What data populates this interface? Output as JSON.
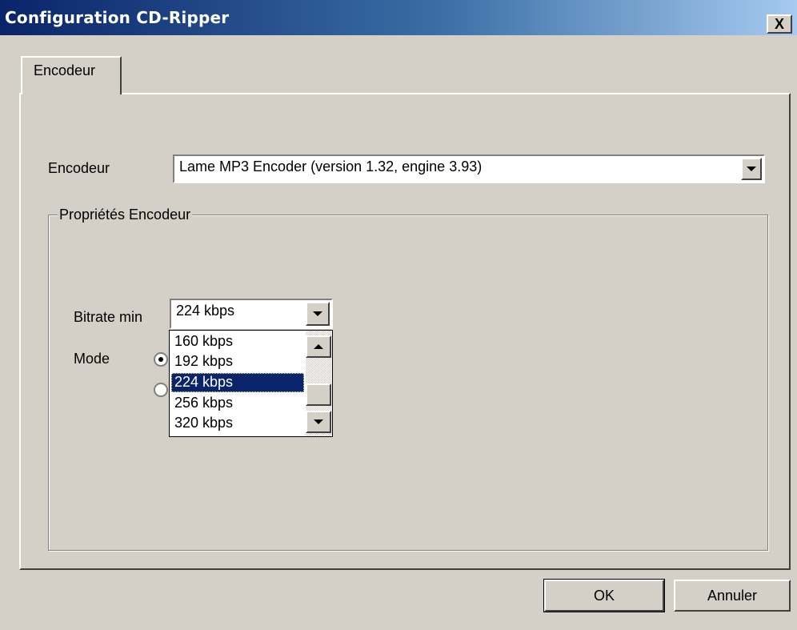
{
  "window": {
    "title": "Configuration CD-Ripper",
    "close_label": "X"
  },
  "tabs": [
    {
      "label": "Encodeur",
      "active": true
    }
  ],
  "encoder": {
    "label": "Encodeur",
    "selected": "Lame MP3 Encoder (version 1.32, engine 3.93)"
  },
  "properties": {
    "group_label": "Propriétés Encodeur",
    "bitrate_label": "Bitrate min",
    "bitrate_value": "224 kbps",
    "mode_label": "Mode",
    "bitrate_options": [
      "160 kbps",
      "192 kbps",
      "224 kbps",
      "256 kbps",
      "320 kbps"
    ],
    "selected_index": 2
  },
  "buttons": {
    "ok": "OK",
    "cancel": "Annuler"
  },
  "colors": {
    "face": "#d4d0c8",
    "title_start": "#0a246a",
    "title_end": "#a6caf0",
    "selection": "#0a246a"
  },
  "icons": [
    "close-icon",
    "dropdown-arrow-icon",
    "scroll-up-icon",
    "scroll-down-icon"
  ]
}
